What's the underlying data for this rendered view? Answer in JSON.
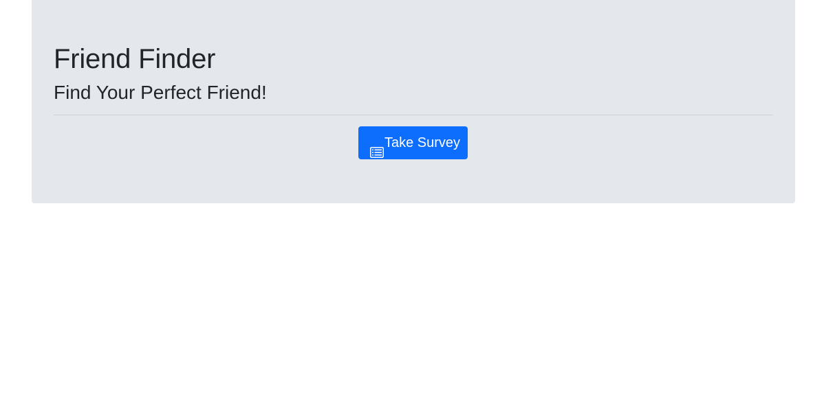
{
  "jumbotron": {
    "title": "Friend Finder",
    "subtitle": "Find Your Perfect Friend!",
    "survey_button": {
      "label": "Take Survey",
      "icon": "list-alt-icon"
    }
  },
  "colors": {
    "jumbotron_bg": "#e4e8ec",
    "button_bg": "#0d6efd",
    "text": "#212529",
    "divider": "#cfd3d7"
  }
}
